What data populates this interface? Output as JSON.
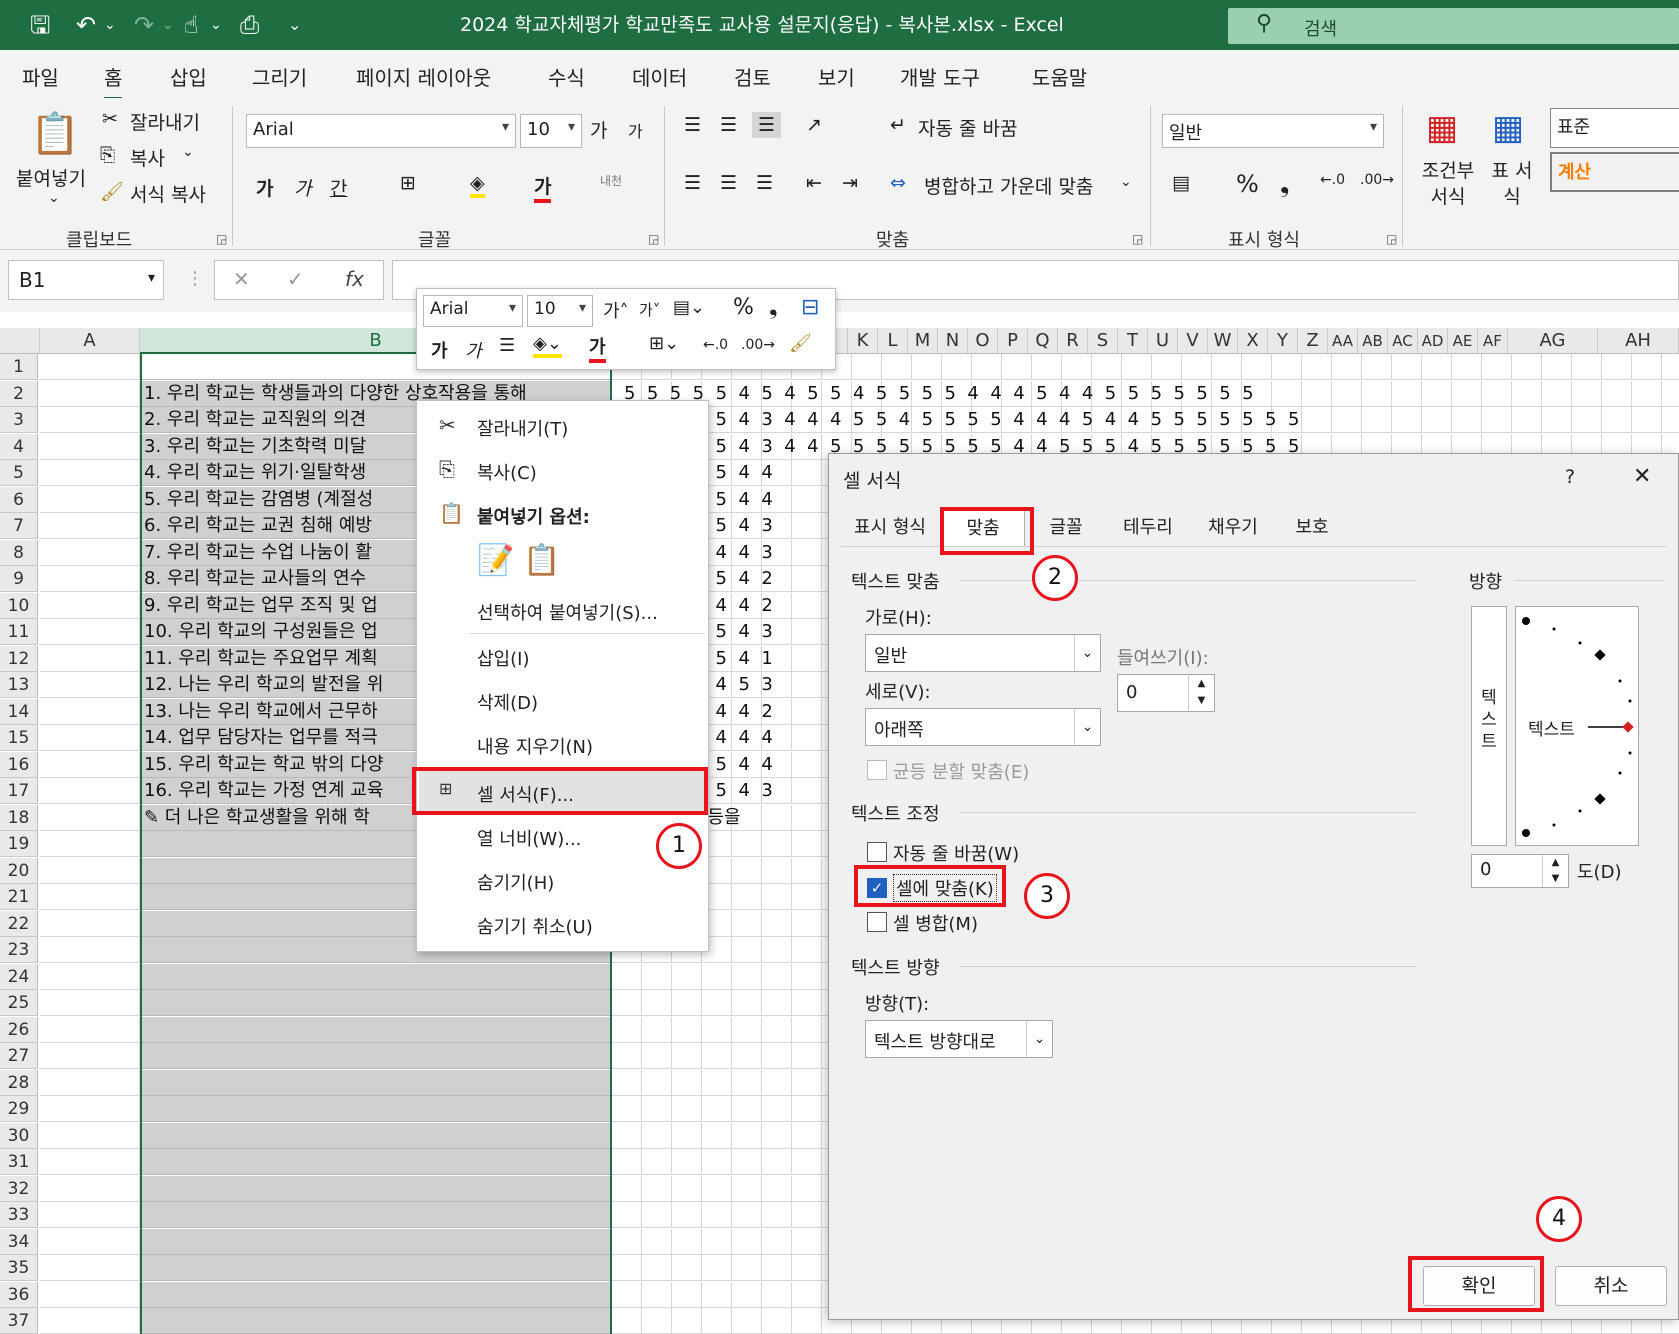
{
  "titlebar": {
    "title": "2024 학교자체평가 학교만족도 교사용 설문지(응답) - 복사본.xlsx  -  Excel",
    "search_placeholder": "검색"
  },
  "menu_tabs": [
    "파일",
    "홈",
    "삽입",
    "그리기",
    "페이지 레이아웃",
    "수식",
    "데이터",
    "검토",
    "보기",
    "개발 도구",
    "도움말"
  ],
  "ribbon": {
    "clipboard": {
      "paste": "붙여넣기",
      "cut": "잘라내기",
      "copy": "복사",
      "format_painter": "서식 복사",
      "group": "클립보드"
    },
    "font": {
      "name": "Arial",
      "size": "10",
      "grow": "가",
      "shrink": "가",
      "bold": "가",
      "italic": "가",
      "underline": "간",
      "font_color": "가",
      "phonetic": "내천",
      "group": "글꼴"
    },
    "alignment": {
      "wrap": "자동 줄 바꿈",
      "merge": "병합하고 가운데 맞춤",
      "group": "맞춤"
    },
    "number": {
      "format": "일반",
      "group": "표시 형식"
    },
    "styles": {
      "conditional": "조건부 서식",
      "table": "표 서식",
      "normal": "표준",
      "calc": "계산"
    }
  },
  "formula_bar": {
    "name_box": "B1",
    "fx": "fx"
  },
  "grid": {
    "col_a": "A",
    "col_b": "B",
    "right_cols": [
      "K",
      "L",
      "M",
      "N",
      "O",
      "P",
      "Q",
      "R",
      "S",
      "T",
      "U",
      "V",
      "W",
      "X",
      "Y",
      "Z",
      "AA",
      "AB",
      "AC",
      "AD",
      "AE",
      "AF"
    ],
    "col_ag": "AG",
    "col_ah": "AH",
    "rows": [
      "1",
      "2",
      "3",
      "4",
      "5",
      "6",
      "7",
      "8",
      "9",
      "10",
      "11",
      "12",
      "13",
      "14",
      "15",
      "16",
      "17",
      "18",
      "19",
      "20",
      "21",
      "22",
      "23",
      "24",
      "25",
      "26",
      "27",
      "28",
      "29",
      "30",
      "31",
      "32",
      "33",
      "34",
      "35",
      "36",
      "37"
    ],
    "b_cells": [
      "",
      "1. 우리 학교는 학생들과의 다양한 상호작용을 통해",
      "2. 우리 학교는 교직원의 의견",
      "3. 우리 학교는 기초학력 미달",
      "4. 우리 학교는 위기·일탈학생",
      "5. 우리 학교는 감염병 (계절성",
      "6. 우리 학교는 교권 침해 예방",
      "7. 우리 학교는 수업 나눔이 활",
      "8. 우리 학교는 교사들의 연수",
      "9. 우리 학교는 업무 조직 및 업",
      "10. 우리 학교의 구성원들은 업",
      "11. 우리 학교는 주요업무 계획",
      "12. 나는 우리 학교의 발전을 위",
      "13. 나는 우리 학교에서 근무하",
      "14. 업무 담당자는 업무를 적극",
      "15. 우리 학교는 학교 밖의 다양",
      "16. 우리 학교는 가정 연계 교육",
      "✎ 더 나은 학교생활을 위해 학"
    ],
    "data_rows": [
      "",
      "5  5  5  5  5  4  5  4  5  5  4  5  5  5  5  4  4  4  5  4  4  5  5  5  5  5  5  5",
      "            5  5  4  3  4  4  4  5  5  4  5  5  5  5  4  4  4  5  4  4  5  5  5  5  5  5  5",
      "            5  5  4  3  4  4  5  5  5  5  5  5  5  5  4  4  5  5  5  4  5  5  5  5  5  5  5",
      "            5  5  4  4",
      "            5  5  4  4",
      "            5  5  4  3",
      "            5  4  4  3",
      "            5  5  4  2",
      "            5  4  4  2",
      "            5  5  4  3",
      "            5  5  4  1",
      "            5  4  5  3",
      "            5  4  4  2",
      "            5  4  4  4",
      "            5  5  4  4",
      "            5  5  4  3",
      "  건의사항 등을"
    ]
  },
  "mini_toolbar": {
    "font": "Arial",
    "size": "10"
  },
  "context_menu": {
    "cut": "잘라내기(T)",
    "copy": "복사(C)",
    "paste_options": "붙여넣기 옵션:",
    "paste_special": "선택하여 붙여넣기(S)...",
    "insert": "삽입(I)",
    "delete": "삭제(D)",
    "clear": "내용 지우기(N)",
    "format_cells": "셀 서식(F)...",
    "col_width": "열 너비(W)...",
    "hide": "숨기기(H)",
    "unhide": "숨기기 취소(U)"
  },
  "dialog": {
    "title": "셀 서식",
    "help": "?",
    "close": "✕",
    "tabs": [
      "표시 형식",
      "맞춤",
      "글꼴",
      "테두리",
      "채우기",
      "보호"
    ],
    "text_align_section": "텍스트 맞춤",
    "horizontal_label": "가로(H):",
    "horizontal_value": "일반",
    "indent_label": "들여쓰기(I):",
    "indent_value": "0",
    "vertical_label": "세로(V):",
    "vertical_value": "아래쪽",
    "justify_distributed": "균등 분할 맞춤(E)",
    "text_control_section": "텍스트 조정",
    "wrap_text": "자동 줄 바꿈(W)",
    "shrink_to_fit": "셀에 맞춤(K)",
    "merge_cells": "셀 병합(M)",
    "rtl_section": "텍스트 방향",
    "direction_label": "방향(T):",
    "direction_value": "텍스트 방향대로",
    "orientation_section": "방향",
    "vertical_text": "텍\n스\n트",
    "orient_text": "텍스트",
    "degrees_value": "0",
    "degrees_label": "도(D)",
    "ok": "확인",
    "cancel": "취소"
  },
  "annotations": [
    "1",
    "2",
    "3",
    "4"
  ],
  "colors": {
    "excel_green": "#1e6e42",
    "highlight_red": "#e8141c",
    "checkbox_blue": "#1f5fbf"
  }
}
